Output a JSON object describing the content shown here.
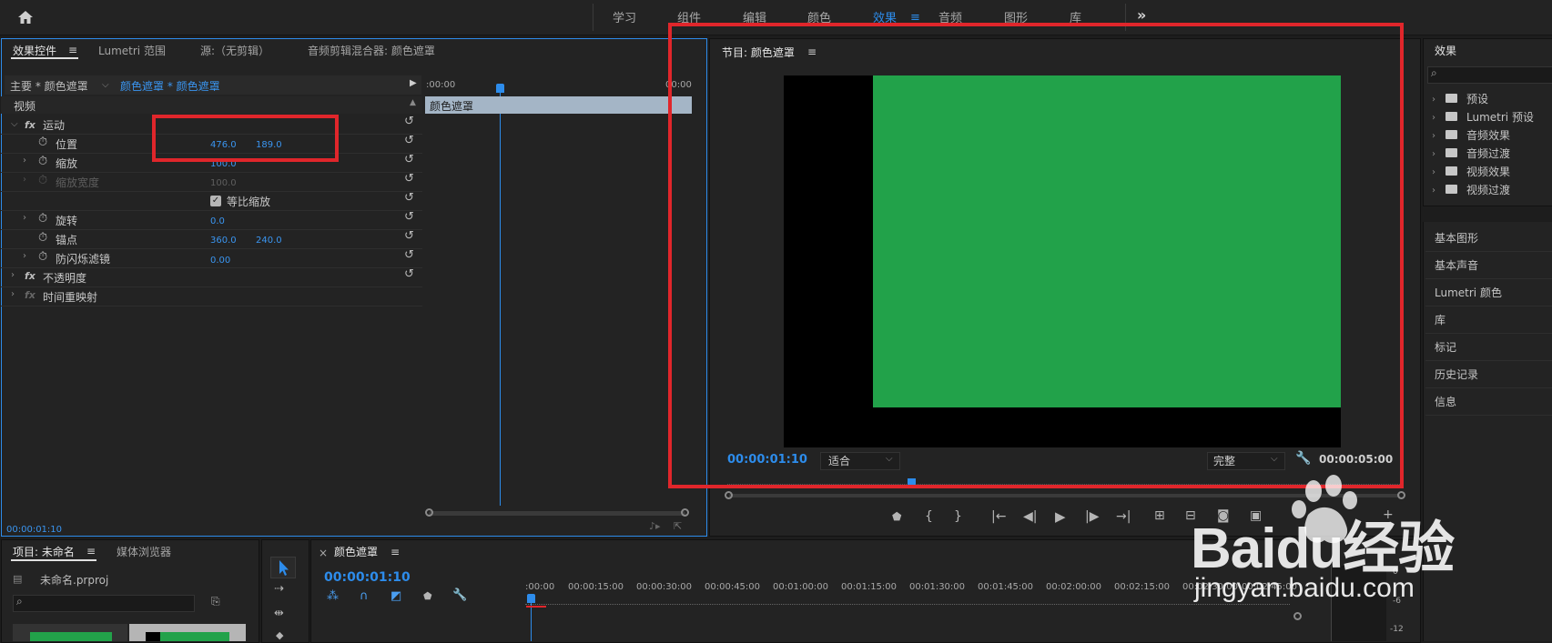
{
  "workspaces": {
    "tabs": [
      "学习",
      "组件",
      "编辑",
      "颜色",
      "效果",
      "音频",
      "图形",
      "库"
    ],
    "active": "效果",
    "more": "»"
  },
  "effect_controls": {
    "tabs": [
      "效果控件",
      "Lumetri 范围",
      "源:（无剪辑）",
      "音频剪辑混合器: 颜色遮罩"
    ],
    "master_label": "主要 * 颜色遮罩",
    "clip_label": "颜色遮罩 * 颜色遮罩",
    "timeline_start": ":00:00",
    "timeline_end": "00:00",
    "clip_bar_label": "颜色遮罩",
    "section_video": "视频",
    "motion": "运动",
    "position": {
      "label": "位置",
      "x": "476.0",
      "y": "189.0"
    },
    "scale": {
      "label": "缩放",
      "value": "100.0"
    },
    "scale_width": {
      "label": "缩放宽度",
      "value": "100.0"
    },
    "uniform_scale": "等比缩放",
    "rotation": {
      "label": "旋转",
      "value": "0.0"
    },
    "anchor": {
      "label": "锚点",
      "x": "360.0",
      "y": "240.0"
    },
    "flicker": {
      "label": "防闪烁滤镜",
      "value": "0.00"
    },
    "opacity": "不透明度",
    "time_remap": "时间重映射",
    "footer_timecode": "00:00:01:10"
  },
  "program": {
    "title": "节目: 颜色遮罩",
    "timecode": "00:00:01:10",
    "fit_label": "适合",
    "quality_label": "完整",
    "duration": "00:00:05:00",
    "video_color": "#22a24a"
  },
  "effects_panel": {
    "title": "效果",
    "search_placeholder": "",
    "folders": [
      "预设",
      "Lumetri 预设",
      "音频效果",
      "音频过渡",
      "视频效果",
      "视频过渡"
    ]
  },
  "right_panels": [
    "基本图形",
    "基本声音",
    "Lumetri 颜色",
    "库",
    "标记",
    "历史记录",
    "信息"
  ],
  "project": {
    "tabs": [
      "项目: 未命名",
      "媒体浏览器"
    ],
    "file": "未命名.prproj"
  },
  "timeline": {
    "close": "×",
    "title": "颜色遮罩",
    "timecode": "00:00:01:10",
    "ruler": [
      ":00:00",
      "00:00:15:00",
      "00:00:30:00",
      "00:00:45:00",
      "00:01:00:00",
      "00:01:15:00",
      "00:01:30:00",
      "00:01:45:00",
      "00:02:00:00",
      "00:02:15:00",
      "00:02:30:00",
      "00:02:45:00"
    ]
  },
  "meter_labels": [
    "0",
    "-6",
    "-12"
  ],
  "watermark": {
    "brand": "Baidu经验",
    "url": "jingyan.baidu.com"
  },
  "colors": {
    "accent": "#2d8ceb",
    "highlight_box": "#e0262b",
    "green": "#22a24a"
  }
}
